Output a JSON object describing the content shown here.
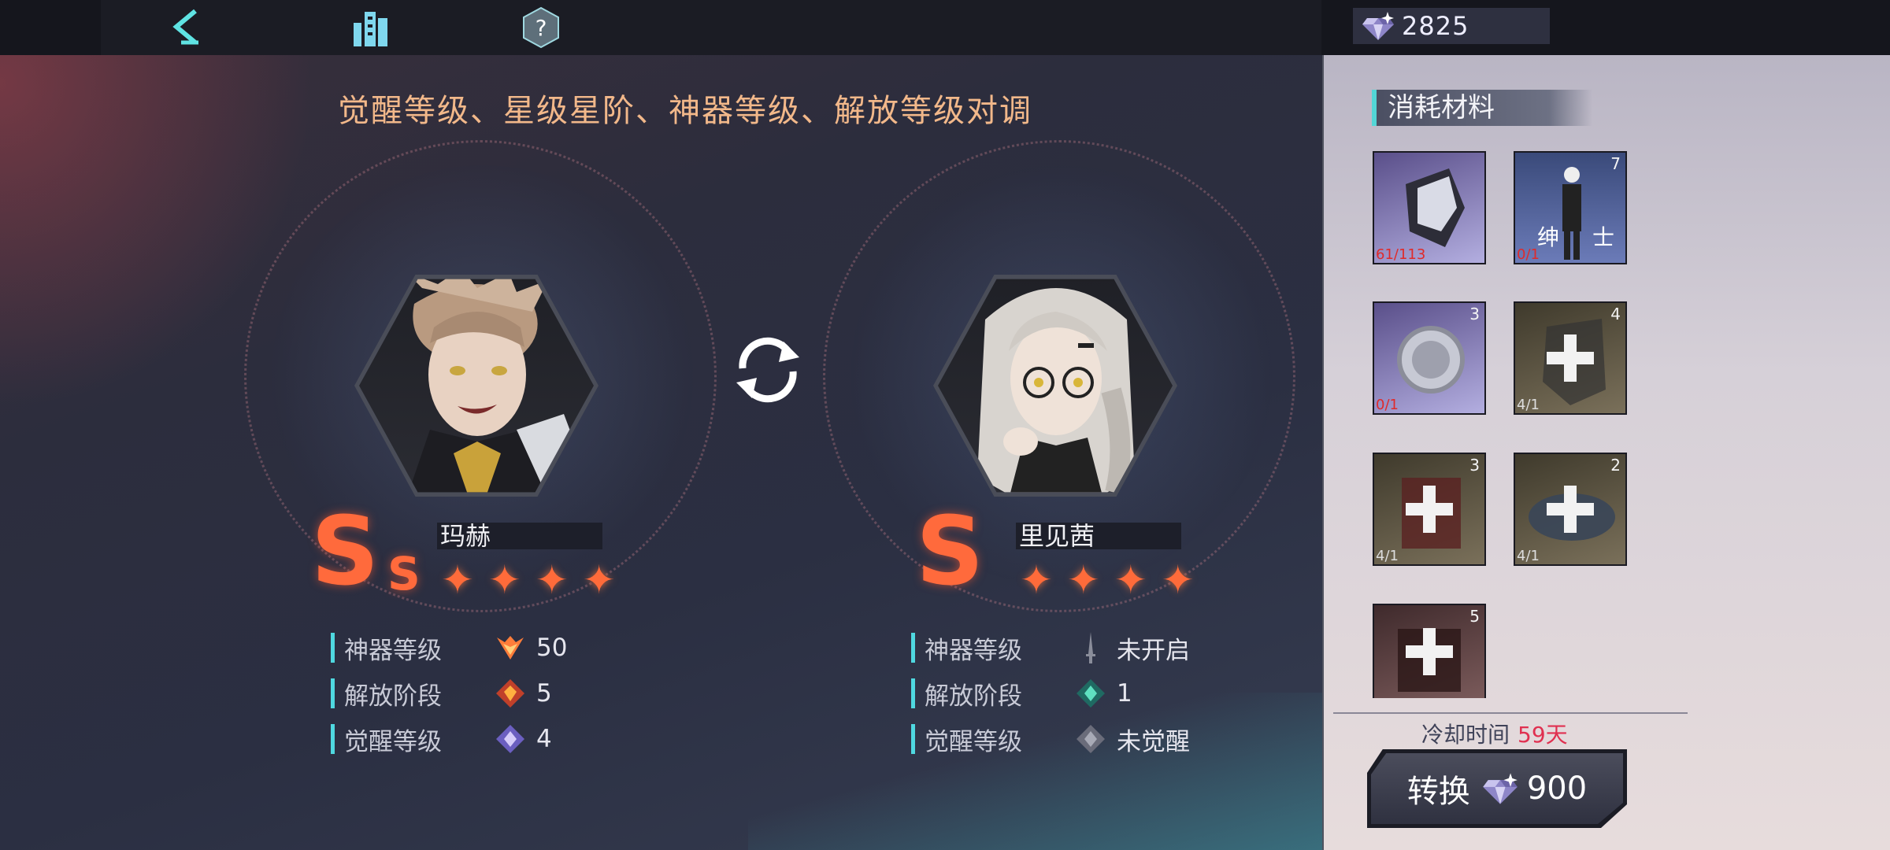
{
  "topbar": {
    "back_icon": "back-arrow-icon",
    "base_icon": "city-buildings-icon",
    "help_icon": "help-icon",
    "currency_value": "2825"
  },
  "title": "觉醒等级、星级星阶、神器等级、解放等级对调",
  "left_character": {
    "name": "玛赫",
    "rank": "S",
    "rank_sub": "S",
    "stars": 4,
    "stats": [
      {
        "label": "神器等级",
        "value": "50"
      },
      {
        "label": "解放阶段",
        "value": "5"
      },
      {
        "label": "觉醒等级",
        "value": "4"
      }
    ]
  },
  "right_character": {
    "name": "里见茜",
    "rank": "S",
    "stars": 4,
    "stats": [
      {
        "label": "神器等级",
        "value": "未开启"
      },
      {
        "label": "解放阶段",
        "value": "1"
      },
      {
        "label": "觉醒等级",
        "value": "未觉醒"
      }
    ]
  },
  "materials": {
    "title": "消耗材料",
    "items": [
      {
        "count": "",
        "requirement": "61/113",
        "insufficient": true
      },
      {
        "count": "7",
        "requirement": "0/1",
        "insufficient": true,
        "label_left": "绅",
        "label_right": "士"
      },
      {
        "count": "3",
        "requirement": "0/1",
        "insufficient": true
      },
      {
        "count": "4",
        "requirement": "4/1",
        "insufficient": false
      },
      {
        "count": "3",
        "requirement": "4/1",
        "insufficient": false
      },
      {
        "count": "2",
        "requirement": "4/1",
        "insufficient": false
      },
      {
        "count": "5",
        "requirement": "",
        "insufficient": false
      }
    ]
  },
  "cooldown": {
    "label": "冷却时间",
    "value": "59天"
  },
  "convert": {
    "label": "转换",
    "cost": "900"
  },
  "colors": {
    "accent_cyan": "#4fd8e0",
    "rank_red": "#ff6a3c",
    "title_orange": "#f2b88a",
    "cooldown_red": "#e03050"
  }
}
